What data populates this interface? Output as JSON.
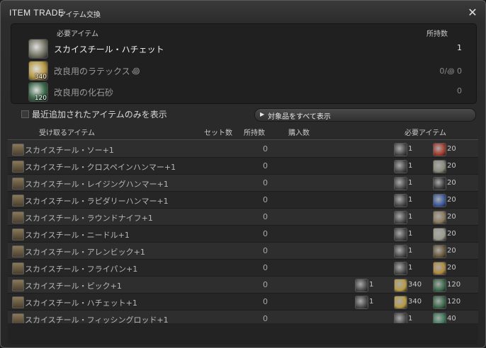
{
  "window": {
    "title": "ITEM TRADE",
    "subtitle": "アイテム交換",
    "close_icon": "crossed-tools-icon"
  },
  "required_panel": {
    "col_item": "必要アイテム",
    "col_owned": "所持数",
    "items": [
      {
        "name": "スカイスチール・ハチェット",
        "icon_qty": "",
        "owned": "1",
        "icon": "hatchet-icon",
        "icon_color": "#7a7a6a",
        "bright": true
      },
      {
        "name": "改良用のラテックス",
        "name_suffix": "꩜",
        "icon_qty": "340",
        "owned": "0/꩜ 0",
        "icon": "latex-icon",
        "icon_color": "#b89a40",
        "bright": false
      },
      {
        "name": "改良用の化石砂",
        "icon_qty": "120",
        "owned": "0",
        "icon": "fossil-sand-icon",
        "icon_color": "#3a6a4a",
        "bright": false
      }
    ]
  },
  "filter": {
    "label": "最近追加されたアイテムのみを表示",
    "checked": false,
    "show_all_label": "対象品をすべて表示"
  },
  "table": {
    "headers": {
      "receive": "受け取るアイテム",
      "sets": "セット数",
      "owned": "所持数",
      "buy": "購入数",
      "required": "必要アイテム"
    },
    "rows": [
      {
        "name": "スカイスチール・ソー+1",
        "owned": "0",
        "costs": [
          {
            "qty": "1",
            "icon": "hatchet-icon",
            "color": "#4a4a4a"
          },
          {
            "qty": "20",
            "icon": "red-material-icon",
            "color": "#a83a2a"
          }
        ]
      },
      {
        "name": "スカイスチール・クロスペインハンマー+1",
        "owned": "0",
        "costs": [
          {
            "qty": "1",
            "icon": "hatchet-icon",
            "color": "#4a4a4a"
          },
          {
            "qty": "20",
            "icon": "ore-icon",
            "color": "#8a8a7a"
          }
        ]
      },
      {
        "name": "スカイスチール・レイジングハンマー+1",
        "owned": "0",
        "costs": [
          {
            "qty": "1",
            "icon": "hatchet-icon",
            "color": "#4a4a4a"
          },
          {
            "qty": "20",
            "icon": "dark-material-icon",
            "color": "#3a3a3a"
          }
        ]
      },
      {
        "name": "スカイスチール・ラピダリーハンマー+1",
        "owned": "0",
        "costs": [
          {
            "qty": "1",
            "icon": "hatchet-icon",
            "color": "#4a4a4a"
          },
          {
            "qty": "20",
            "icon": "blue-crystal-icon",
            "color": "#3a5aa0"
          }
        ]
      },
      {
        "name": "スカイスチール・ラウンドナイフ+1",
        "owned": "0",
        "costs": [
          {
            "qty": "1",
            "icon": "hammer-icon",
            "color": "#4a4a4a"
          },
          {
            "qty": "20",
            "icon": "leather-icon",
            "color": "#8a7a5a"
          }
        ]
      },
      {
        "name": "スカイスチール・ニードル+1",
        "owned": "0",
        "costs": [
          {
            "qty": "1",
            "icon": "needle-icon",
            "color": "#4a4a4a"
          },
          {
            "qty": "20",
            "icon": "cloth-icon",
            "color": "#9a9a8a"
          }
        ]
      },
      {
        "name": "スカイスチール・アレンビック+1",
        "owned": "0",
        "costs": [
          {
            "qty": "1",
            "icon": "alembic-icon",
            "color": "#4a4a4a"
          },
          {
            "qty": "20",
            "icon": "wood-icon",
            "color": "#6a5a3a"
          }
        ]
      },
      {
        "name": "スカイスチール・フライパン+1",
        "owned": "0",
        "costs": [
          {
            "qty": "1",
            "icon": "pan-icon",
            "color": "#4a4a4a"
          },
          {
            "qty": "20",
            "icon": "food-icon",
            "color": "#b08a3a"
          }
        ]
      },
      {
        "name": "スカイスチール・ピック+1",
        "owned": "0",
        "costs": [
          {
            "qty": "1",
            "icon": "hatchet-icon",
            "color": "#4a4a4a"
          },
          {
            "qty": "340",
            "icon": "latex-icon",
            "color": "#b89a40"
          },
          {
            "qty": "120",
            "icon": "fossil-sand-icon",
            "color": "#3a6a4a"
          }
        ]
      },
      {
        "name": "スカイスチール・ハチェット+1",
        "owned": "0",
        "costs": [
          {
            "qty": "1",
            "icon": "hatchet-icon",
            "color": "#4a4a4a"
          },
          {
            "qty": "340",
            "icon": "latex-icon",
            "color": "#b89a40"
          },
          {
            "qty": "120",
            "icon": "fossil-sand-icon",
            "color": "#3a6a4a"
          }
        ]
      },
      {
        "name": "スカイスチール・フィッシングロッド+1",
        "owned": "0",
        "costs": [
          {
            "qty": "1",
            "icon": "hatchet-icon",
            "color": "#4a4a4a"
          },
          {
            "qty": "40",
            "icon": "green-material-icon",
            "color": "#3a7a5a"
          }
        ]
      }
    ]
  }
}
